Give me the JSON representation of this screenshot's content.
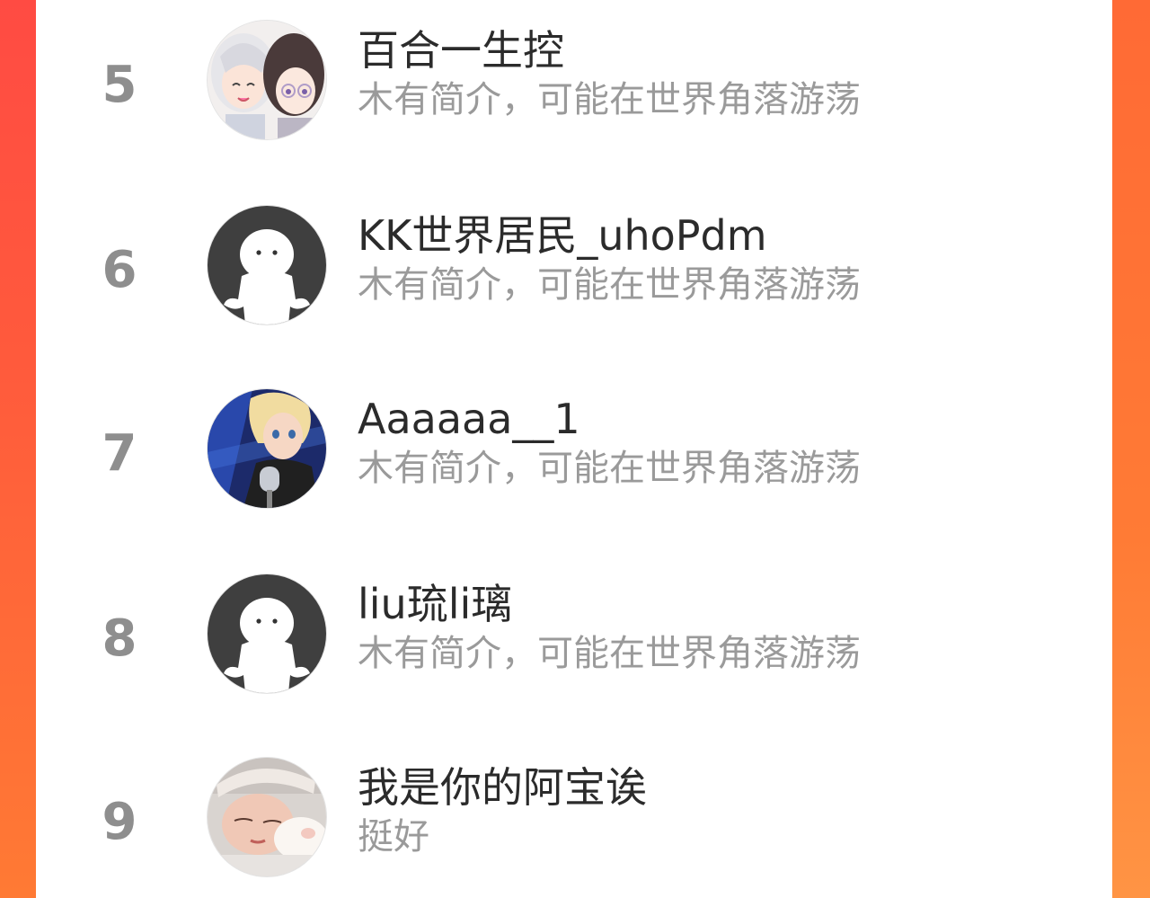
{
  "colors": {
    "frame_red": "#ff4b43",
    "frame_orange": "#ff7a34",
    "rank_gray": "#8e8e8e",
    "name_text": "#2b2b2b",
    "bio_text": "#9a9a9a",
    "default_avatar_bg": "#3f3f3f"
  },
  "ranking": {
    "rows": [
      {
        "rank": "5",
        "name": "百合一生控",
        "bio": "木有简介，可能在世界角落游荡",
        "avatar": "anime-duo-avatar"
      },
      {
        "rank": "6",
        "name": "KK世界居民_uhoPdm",
        "bio": "木有简介，可能在世界角落游荡",
        "avatar": "default-ghost-avatar"
      },
      {
        "rank": "7",
        "name": "Aaaaaa__1",
        "bio": "木有简介，可能在世界角落游荡",
        "avatar": "singer-avatar"
      },
      {
        "rank": "8",
        "name": "liu琉li璃",
        "bio": "木有简介，可能在世界角落游荡",
        "avatar": "default-ghost-avatar"
      },
      {
        "rank": "9",
        "name": "我是你的阿宝诶",
        "bio": "挺好",
        "avatar": "sleeping-girl-avatar"
      }
    ]
  }
}
